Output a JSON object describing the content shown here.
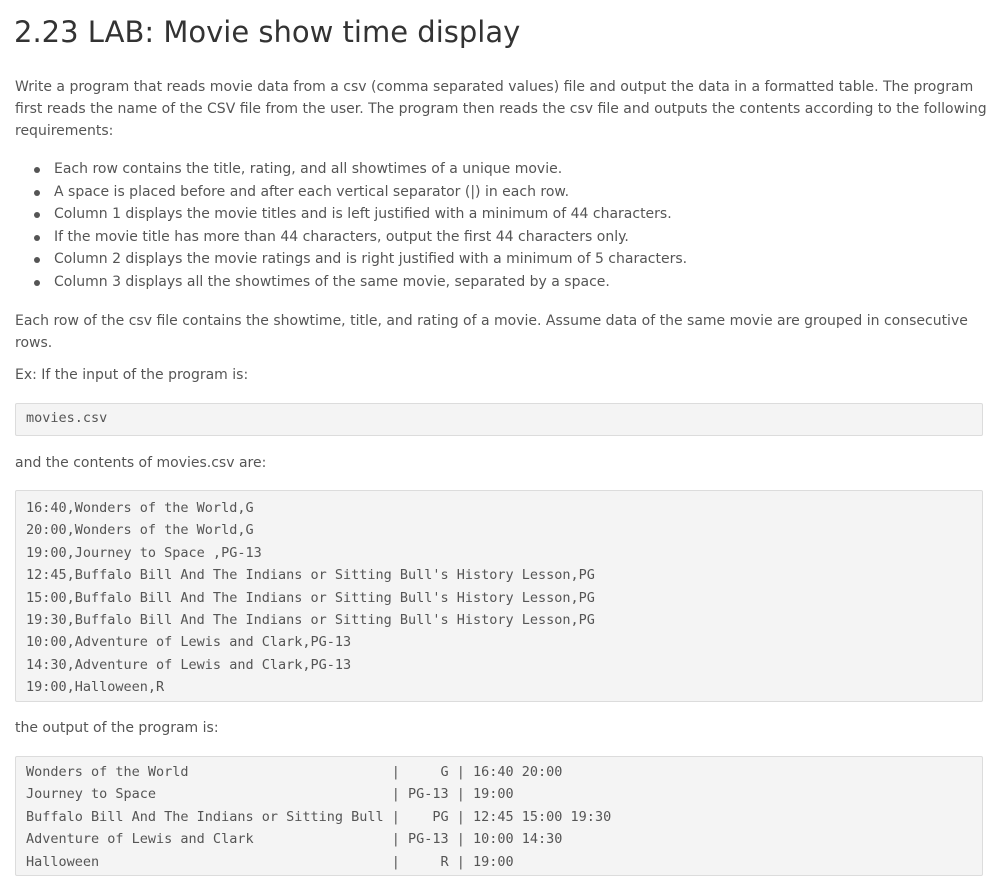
{
  "title": "2.23 LAB: Movie show time display",
  "intro": [
    "Write a program that reads movie data from a csv (comma separated values) file and output the data in a formatted table. The program",
    "first reads the name of the CSV file from the user. The program then reads the csv file and outputs the contents according to the following",
    "requirements:"
  ],
  "requirements": [
    "Each row contains the title, rating, and all showtimes of a unique movie.",
    "A space is placed before and after each vertical separator (|) in each row.",
    "Column 1 displays the movie titles and is left justified with a minimum of 44 characters.",
    "If the movie title has more than 44 characters, output the first 44 characters only.",
    "Column 2 displays the movie ratings and is right justified with a minimum of 5 characters.",
    "Column 3 displays all the showtimes of the same movie, separated by a space."
  ],
  "csv_desc": [
    "Each row of the csv file contains the showtime, title, and rating of a movie. Assume data of the same movie are grouped in consecutive",
    "rows."
  ],
  "example_intro": "Ex: If the input of the program is:",
  "input_value": "movies.csv",
  "contents_intro": "and the contents of movies.csv are:",
  "csv_lines": [
    "16:40,Wonders of the World,G",
    "20:00,Wonders of the World,G",
    "19:00,Journey to Space ,PG-13",
    "12:45,Buffalo Bill And The Indians or Sitting Bull's History Lesson,PG",
    "15:00,Buffalo Bill And The Indians or Sitting Bull's History Lesson,PG",
    "19:30,Buffalo Bill And The Indians or Sitting Bull's History Lesson,PG",
    "10:00,Adventure of Lewis and Clark,PG-13",
    "14:30,Adventure of Lewis and Clark,PG-13",
    "19:00,Halloween,R"
  ],
  "output_intro": "the output of the program is:",
  "output_lines": [
    "Wonders of the World                         |     G | 16:40 20:00",
    "Journey to Space                             | PG-13 | 19:00",
    "Buffalo Bill And The Indians or Sitting Bull |    PG | 12:45 15:00 19:30",
    "Adventure of Lewis and Clark                 | PG-13 | 10:00 14:30",
    "Halloween                                    |     R | 19:00"
  ]
}
